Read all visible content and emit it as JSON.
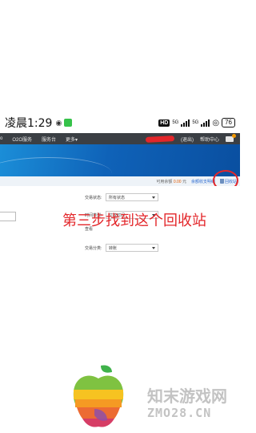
{
  "status_bar": {
    "time": "凌晨1:29",
    "hd": "HD",
    "net1": "5G",
    "net2": "5G",
    "battery": "76"
  },
  "top_nav": {
    "items": [
      "o",
      "O2O服务",
      "服务台",
      "更多▾"
    ],
    "right_items": [
      "(退出)",
      "帮助中心"
    ]
  },
  "balance_bar": {
    "label": "可用余额",
    "amount": "0.00",
    "unit": "元",
    "details_link": "余额收支明细",
    "recycle_label": "回收站"
  },
  "filters": {
    "status": {
      "label": "交易状态:",
      "value": "所有状态"
    },
    "time_type": {
      "label": "时间类型:",
      "value": "付款时间"
    },
    "hidden_row_label": "查看",
    "category": {
      "label": "交易分类:",
      "value": "转账"
    }
  },
  "overlay": {
    "instruction": "第三步找到这个回收站"
  },
  "watermark": {
    "brand_cn": "知末游戏网",
    "brand_en": "ZMO28.CN"
  },
  "colors": {
    "annotation_red": "#e3262a",
    "banner_blue": "#1b8ed8",
    "nav_dark": "#3b3f44"
  }
}
